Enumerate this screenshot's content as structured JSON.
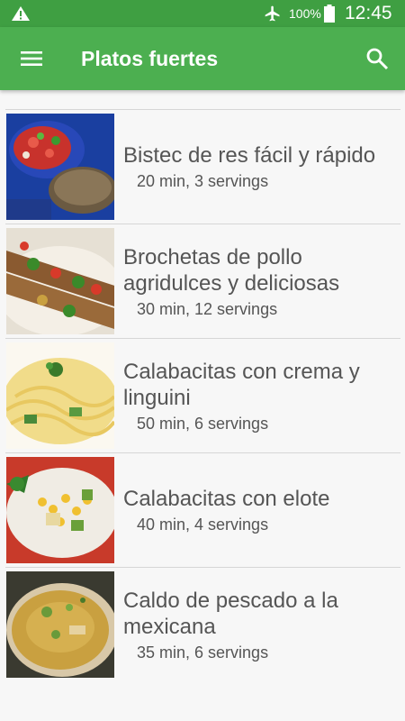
{
  "status_bar": {
    "battery_percent": "100%",
    "time": "12:45",
    "icons": [
      "warning-icon",
      "airplane-mode-icon",
      "battery-icon"
    ]
  },
  "app_bar": {
    "title": "Platos fuertes",
    "icons": [
      "menu-icon",
      "search-icon"
    ]
  },
  "colors": {
    "status_bar": "#3f9f42",
    "app_bar": "#4caf50",
    "background": "#f7f7f7",
    "text": "#555555"
  },
  "recipes": [
    {
      "title": "Bistec de res fácil y rápido",
      "meta": "20 min, 3 servings"
    },
    {
      "title": "Brochetas de pollo agridulces y deliciosas",
      "meta": "30 min, 12 servings"
    },
    {
      "title": "Calabacitas con crema y linguini",
      "meta": "50 min, 6 servings"
    },
    {
      "title": "Calabacitas con elote",
      "meta": "40 min, 4 servings"
    },
    {
      "title": "Caldo de pescado a la mexicana",
      "meta": "35 min, 6 servings"
    }
  ]
}
